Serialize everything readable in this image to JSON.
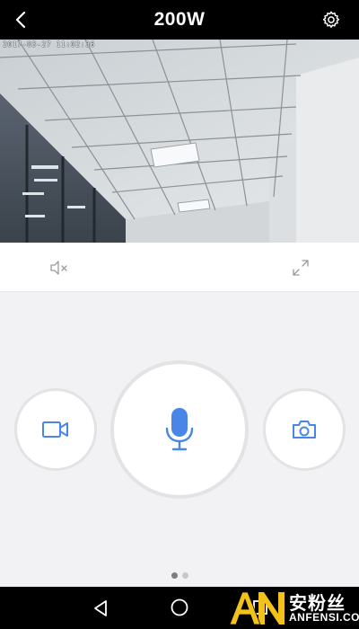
{
  "header": {
    "title": "200W",
    "back_icon": "chevron-left-icon",
    "settings_icon": "gear-icon"
  },
  "video": {
    "osd_timestamp": "2017-03-27 11:02:36"
  },
  "controls": {
    "mute_icon": "speaker-muted-icon",
    "fullscreen_icon": "expand-icon"
  },
  "actions": {
    "record_icon": "video-camera-icon",
    "talk_icon": "microphone-icon",
    "snapshot_icon": "camera-icon",
    "accent_color": "#4a86e8"
  },
  "pager": {
    "current_page": 1,
    "total_pages": 2
  },
  "system_nav": {
    "back_icon": "triangle-back-icon",
    "home_icon": "circle-home-icon",
    "recent_icon": "square-recent-icon"
  },
  "watermark": {
    "chinese_text": "安粉丝",
    "english_text": "ANFENSI.COM"
  }
}
